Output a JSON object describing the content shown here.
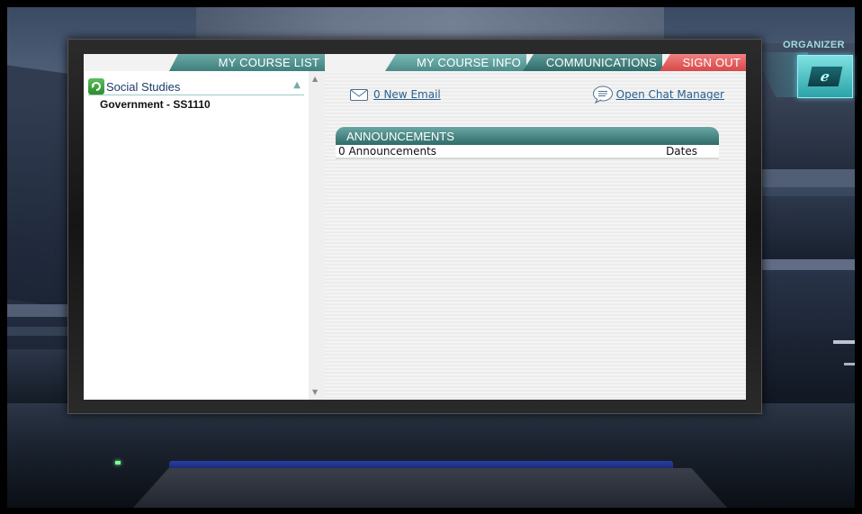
{
  "tabs": {
    "course_list": "MY COURSE LIST",
    "course_info": "MY COURSE INFO",
    "communications": "COMMUNICATIONS",
    "sign_out": "SIGN OUT"
  },
  "sidebar": {
    "subject": "Social Studies",
    "courses": [
      {
        "label": "Government - SS1110"
      }
    ]
  },
  "main": {
    "email_link": "0 New Email",
    "chat_link": "Open Chat Manager",
    "announcements": {
      "header": "ANNOUNCEMENTS",
      "count_label": "0 Announcements",
      "dates_label": "Dates"
    }
  },
  "organizer": {
    "label": "ORGANIZER",
    "icon_glyph": "e"
  },
  "colors": {
    "teal_tab": "#3e7f7c",
    "signout_red": "#d94848",
    "link_blue": "#2a5f8f",
    "organizer_cyan": "#2aa3a8"
  }
}
